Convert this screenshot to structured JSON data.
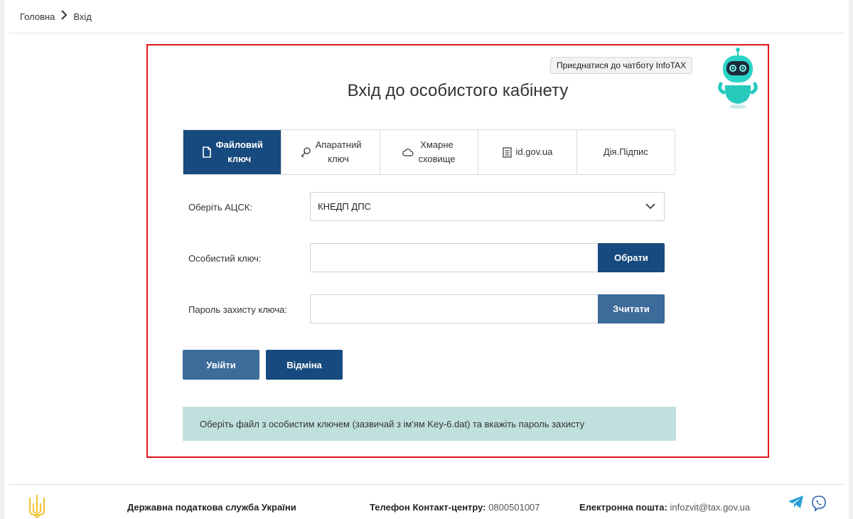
{
  "breadcrumb": {
    "home": "Головна",
    "current": "Вхід"
  },
  "chatbot": {
    "label": "Приєднатися до чатботу InfoTAX"
  },
  "title": "Вхід до особистого кабінету",
  "tabs": [
    {
      "line1": "Файловий",
      "line2": "ключ",
      "icon": "file-icon",
      "active": true
    },
    {
      "line1": "Апаратний",
      "line2": "ключ",
      "icon": "key-icon",
      "active": false
    },
    {
      "line1": "Хмарне",
      "line2": "сховище",
      "icon": "cloud-icon",
      "active": false
    },
    {
      "line1": "id.gov.ua",
      "line2": "",
      "icon": "document-icon",
      "active": false
    },
    {
      "line1": "Дія.Підпис",
      "line2": "",
      "icon": "",
      "active": false
    }
  ],
  "form": {
    "acsk_label": "Оберіть АЦСК:",
    "acsk_value": "КНЕДП ДПС",
    "key_label": "Особистий ключ:",
    "key_value": "",
    "choose_button": "Обрати",
    "password_label": "Пароль захисту ключа:",
    "password_value": "",
    "read_button": "Зчитати",
    "login_button": "Увійти",
    "cancel_button": "Відміна"
  },
  "info": "Оберіть файл з особистим ключем (зазвичай з ім'ям Key-6.dat) та вкажіть пароль захисту",
  "footer": {
    "org": "Державна податкова служба України",
    "phone_label": "Телефон Контакт-центру:",
    "phone_value": "0800501007",
    "email_label": "Електронна пошта:",
    "email_value": "infozvit@tax.gov.ua"
  },
  "colors": {
    "primary": "#174a7e",
    "secondary": "#3d6b9a",
    "info_bg": "#bfe0dd",
    "frame_border": "#e0161d",
    "trident": "#f2c231",
    "telegram": "#2a9fd8",
    "viber": "#2f63a8"
  }
}
